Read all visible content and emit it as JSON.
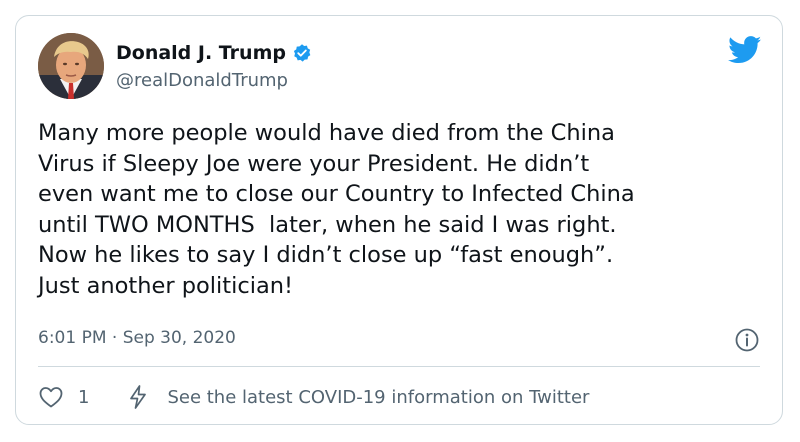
{
  "author": {
    "display_name": "Donald J. Trump",
    "handle": "@realDonaldTrump",
    "verified": true
  },
  "tweet": {
    "text": "Many more people would have died from the China Virus if Sleepy Joe were your President. He didn’t even want me to close our Country to Infected China until TWO MONTHS  later, when he said I was right. Now he likes to say I didn’t close up “fast enough”. Just another politician!",
    "text_lines": [
      "Many more people would have died from the China",
      "Virus if Sleepy Joe were your President. He didn’t",
      "even want me to close our Country to Infected China",
      "until TWO MONTHS  later, when he said I was right.",
      "Now he likes to say I didn’t close up “fast enough”.",
      "Just another politician!"
    ],
    "timestamp": "6:01 PM · Sep 30, 2020"
  },
  "actions": {
    "like_count": "1",
    "covid_info_label": "See the latest COVID-19 information on Twitter"
  },
  "icons": {
    "brand": "twitter-bird-icon",
    "verified": "verified-badge-icon",
    "info": "info-icon",
    "like": "heart-icon",
    "covid": "lightning-bolt-icon"
  },
  "colors": {
    "twitter_blue": "#1d9bf0",
    "text_primary": "#0f1419",
    "text_secondary": "#536471",
    "border": "#cfd9de"
  }
}
